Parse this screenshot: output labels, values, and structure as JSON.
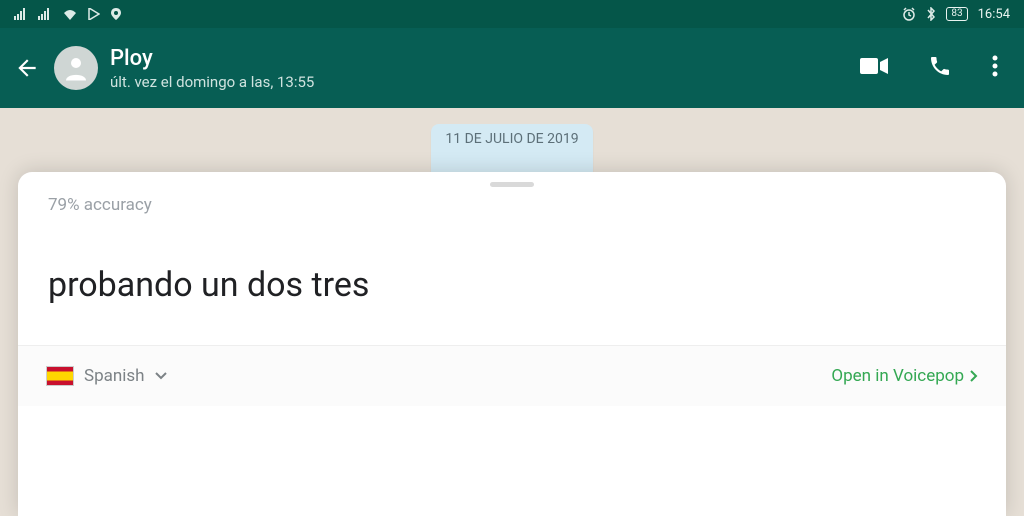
{
  "statusbar": {
    "battery": "83",
    "time": "16:54"
  },
  "chat": {
    "name": "Ploy",
    "subtitle": "últ. vez el domingo a las, 13:55",
    "date_pill": "11 DE JULIO DE 2019"
  },
  "sheet": {
    "accuracy": "79% accuracy",
    "transcript": "probando un dos tres",
    "language": "Spanish",
    "open_label": "Open in Voicepop"
  }
}
